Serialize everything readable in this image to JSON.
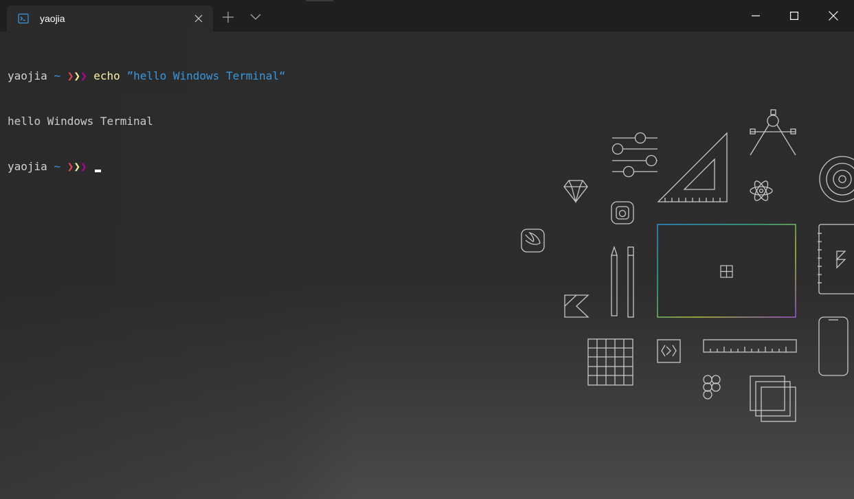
{
  "window": {
    "tab_title": "yaojia",
    "tab_icon": "terminal-icon",
    "new_tab_icon": "plus-icon",
    "dropdown_icon": "chevron-down-icon",
    "minimize_icon": "minimize-icon",
    "maximize_icon": "maximize-icon",
    "close_icon": "close-icon"
  },
  "terminal": {
    "lines": [
      {
        "user": "yaojia",
        "tilde": "~",
        "chevrons": [
          "❯",
          "❯",
          "❯"
        ],
        "command": "echo",
        "argument": "”hello Windows Terminal“"
      },
      {
        "output": "hello Windows Terminal"
      },
      {
        "user": "yaojia",
        "tilde": "~",
        "chevrons": [
          "❯",
          "❯",
          "❯"
        ],
        "command": "",
        "argument": ""
      }
    ]
  },
  "colors": {
    "titlebar": "#1f1f1f",
    "background": "#2b2b2b",
    "prompt_user": "#d4d4d4",
    "prompt_tilde": "#3b8eea",
    "chevron_red": "#e74856",
    "chevron_yellow": "#f9f1a5",
    "chevron_magenta": "#b4009e",
    "command": "#f9f1a5",
    "argument": "#3a96dd"
  },
  "background_art": {
    "icons": [
      "sliders-icon",
      "set-square-icon",
      "compass-icon",
      "target-icon",
      "gem-icon",
      "instagram-icon",
      "react-atom-icon",
      "swift-icon",
      "pencil-icon",
      "pen-icon",
      "surface-screen-icon",
      "windows-logo-icon",
      "framer-icon",
      "kotlin-icon",
      "grid-icon",
      "code-brackets-icon",
      "ruler-icon",
      "phone-icon",
      "figma-icon",
      "layers-icon"
    ]
  }
}
